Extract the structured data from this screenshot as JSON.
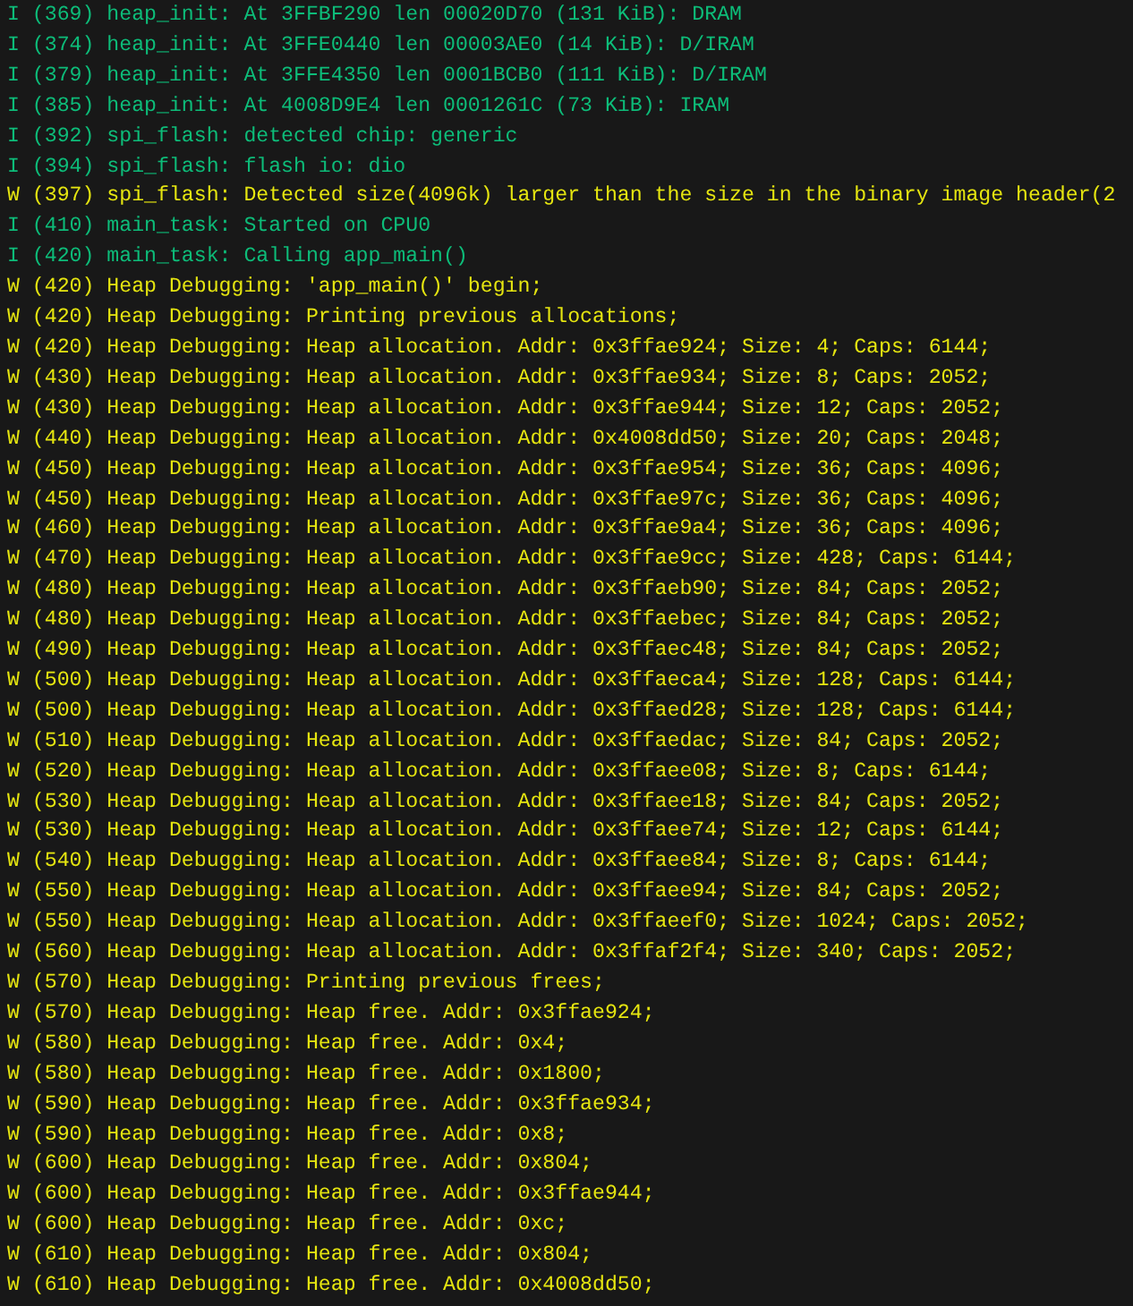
{
  "terminal": {
    "lines": [
      {
        "kind": "info",
        "text": "I (369) heap_init: At 3FFBF290 len 00020D70 (131 KiB): DRAM"
      },
      {
        "kind": "info",
        "text": "I (374) heap_init: At 3FFE0440 len 00003AE0 (14 KiB): D/IRAM"
      },
      {
        "kind": "info",
        "text": "I (379) heap_init: At 3FFE4350 len 0001BCB0 (111 KiB): D/IRAM"
      },
      {
        "kind": "info",
        "text": "I (385) heap_init: At 4008D9E4 len 0001261C (73 KiB): IRAM"
      },
      {
        "kind": "info",
        "text": "I (392) spi_flash: detected chip: generic"
      },
      {
        "kind": "info",
        "text": "I (394) spi_flash: flash io: dio"
      },
      {
        "kind": "warning",
        "text": "W (397) spi_flash: Detected size(4096k) larger than the size in the binary image header(2"
      },
      {
        "kind": "info",
        "text": "I (410) main_task: Started on CPU0"
      },
      {
        "kind": "info",
        "text": "I (420) main_task: Calling app_main()"
      },
      {
        "kind": "warning",
        "text": "W (420) Heap Debugging: 'app_main()' begin;"
      },
      {
        "kind": "warning",
        "text": "W (420) Heap Debugging: Printing previous allocations;"
      },
      {
        "kind": "warning",
        "text": "W (420) Heap Debugging: Heap allocation. Addr: 0x3ffae924; Size: 4; Caps: 6144;"
      },
      {
        "kind": "warning",
        "text": "W (430) Heap Debugging: Heap allocation. Addr: 0x3ffae934; Size: 8; Caps: 2052;"
      },
      {
        "kind": "warning",
        "text": "W (430) Heap Debugging: Heap allocation. Addr: 0x3ffae944; Size: 12; Caps: 2052;"
      },
      {
        "kind": "warning",
        "text": "W (440) Heap Debugging: Heap allocation. Addr: 0x4008dd50; Size: 20; Caps: 2048;"
      },
      {
        "kind": "warning",
        "text": "W (450) Heap Debugging: Heap allocation. Addr: 0x3ffae954; Size: 36; Caps: 4096;"
      },
      {
        "kind": "warning",
        "text": "W (450) Heap Debugging: Heap allocation. Addr: 0x3ffae97c; Size: 36; Caps: 4096;"
      },
      {
        "kind": "warning",
        "text": "W (460) Heap Debugging: Heap allocation. Addr: 0x3ffae9a4; Size: 36; Caps: 4096;"
      },
      {
        "kind": "warning",
        "text": "W (470) Heap Debugging: Heap allocation. Addr: 0x3ffae9cc; Size: 428; Caps: 6144;"
      },
      {
        "kind": "warning",
        "text": "W (480) Heap Debugging: Heap allocation. Addr: 0x3ffaeb90; Size: 84; Caps: 2052;"
      },
      {
        "kind": "warning",
        "text": "W (480) Heap Debugging: Heap allocation. Addr: 0x3ffaebec; Size: 84; Caps: 2052;"
      },
      {
        "kind": "warning",
        "text": "W (490) Heap Debugging: Heap allocation. Addr: 0x3ffaec48; Size: 84; Caps: 2052;"
      },
      {
        "kind": "warning",
        "text": "W (500) Heap Debugging: Heap allocation. Addr: 0x3ffaeca4; Size: 128; Caps: 6144;"
      },
      {
        "kind": "warning",
        "text": "W (500) Heap Debugging: Heap allocation. Addr: 0x3ffaed28; Size: 128; Caps: 6144;"
      },
      {
        "kind": "warning",
        "text": "W (510) Heap Debugging: Heap allocation. Addr: 0x3ffaedac; Size: 84; Caps: 2052;"
      },
      {
        "kind": "warning",
        "text": "W (520) Heap Debugging: Heap allocation. Addr: 0x3ffaee08; Size: 8; Caps: 6144;"
      },
      {
        "kind": "warning",
        "text": "W (530) Heap Debugging: Heap allocation. Addr: 0x3ffaee18; Size: 84; Caps: 2052;"
      },
      {
        "kind": "warning",
        "text": "W (530) Heap Debugging: Heap allocation. Addr: 0x3ffaee74; Size: 12; Caps: 6144;"
      },
      {
        "kind": "warning",
        "text": "W (540) Heap Debugging: Heap allocation. Addr: 0x3ffaee84; Size: 8; Caps: 6144;"
      },
      {
        "kind": "warning",
        "text": "W (550) Heap Debugging: Heap allocation. Addr: 0x3ffaee94; Size: 84; Caps: 2052;"
      },
      {
        "kind": "warning",
        "text": "W (550) Heap Debugging: Heap allocation. Addr: 0x3ffaeef0; Size: 1024; Caps: 2052;"
      },
      {
        "kind": "warning",
        "text": "W (560) Heap Debugging: Heap allocation. Addr: 0x3ffaf2f4; Size: 340; Caps: 2052;"
      },
      {
        "kind": "warning",
        "text": "W (570) Heap Debugging: Printing previous frees;"
      },
      {
        "kind": "warning",
        "text": "W (570) Heap Debugging: Heap free. Addr: 0x3ffae924;"
      },
      {
        "kind": "warning",
        "text": "W (580) Heap Debugging: Heap free. Addr: 0x4;"
      },
      {
        "kind": "warning",
        "text": "W (580) Heap Debugging: Heap free. Addr: 0x1800;"
      },
      {
        "kind": "warning",
        "text": "W (590) Heap Debugging: Heap free. Addr: 0x3ffae934;"
      },
      {
        "kind": "warning",
        "text": "W (590) Heap Debugging: Heap free. Addr: 0x8;"
      },
      {
        "kind": "warning",
        "text": "W (600) Heap Debugging: Heap free. Addr: 0x804;"
      },
      {
        "kind": "warning",
        "text": "W (600) Heap Debugging: Heap free. Addr: 0x3ffae944;"
      },
      {
        "kind": "warning",
        "text": "W (600) Heap Debugging: Heap free. Addr: 0xc;"
      },
      {
        "kind": "warning",
        "text": "W (610) Heap Debugging: Heap free. Addr: 0x804;"
      },
      {
        "kind": "warning",
        "text": "W (610) Heap Debugging: Heap free. Addr: 0x4008dd50;"
      }
    ]
  }
}
